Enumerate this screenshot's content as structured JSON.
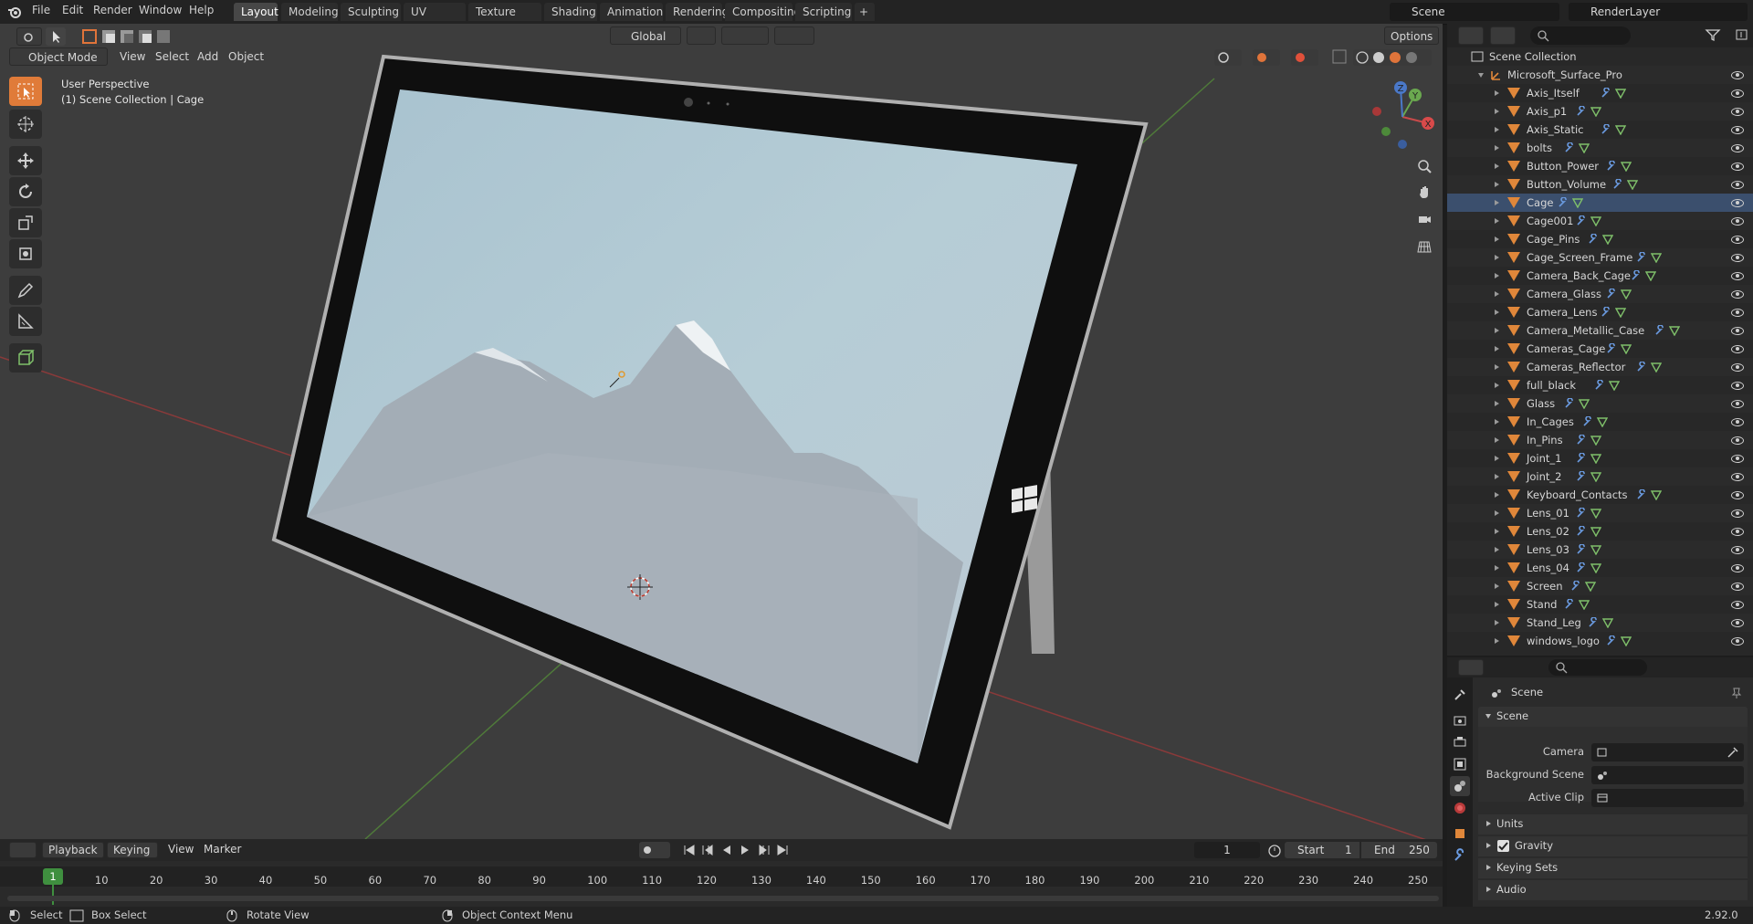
{
  "menubar": {
    "items": [
      "File",
      "Edit",
      "Render",
      "Window",
      "Help"
    ],
    "workspaces": [
      "Layout",
      "Modeling",
      "Sculpting",
      "UV Editing",
      "Texture Paint",
      "Shading",
      "Animation",
      "Rendering",
      "Compositing",
      "Scripting"
    ],
    "active_workspace": "Layout",
    "add_tab": "+",
    "scene_name": "Scene",
    "render_layer": "RenderLayer"
  },
  "viewport": {
    "mode": "Object Mode",
    "menu": [
      "View",
      "Select",
      "Add",
      "Object"
    ],
    "transform_orientation": "Global",
    "options_label": "Options",
    "overlay_title": "User Perspective",
    "overlay_subtitle": "(1) Scene Collection | Cage",
    "gizmo": {
      "x": "X",
      "y": "Y",
      "z": "Z"
    }
  },
  "outliner": {
    "root": "Scene Collection",
    "collection": "Microsoft_Surface_Pro",
    "selected": "Cage",
    "objects": [
      "Axis_Itself",
      "Axis_p1",
      "Axis_Static",
      "bolts",
      "Button_Power",
      "Button_Volume",
      "Cage",
      "Cage001",
      "Cage_Pins",
      "Cage_Screen_Frame",
      "Camera_Back_Cage",
      "Camera_Glass",
      "Camera_Lens",
      "Camera_Metallic_Case",
      "Cameras_Cage",
      "Cameras_Reflector",
      "full_black",
      "Glass",
      "In_Cages",
      "In_Pins",
      "Joint_1",
      "Joint_2",
      "Keyboard_Contacts",
      "Lens_01",
      "Lens_02",
      "Lens_03",
      "Lens_04",
      "Screen",
      "Stand",
      "Stand_Leg",
      "windows_logo"
    ]
  },
  "properties": {
    "context": "Scene",
    "panel_title": "Scene",
    "camera_label": "Camera",
    "background_scene_label": "Background Scene",
    "active_clip_label": "Active Clip",
    "sections": [
      "Units",
      "Gravity",
      "Keying Sets",
      "Audio"
    ],
    "gravity_checked": true
  },
  "timeline": {
    "playback": "Playback",
    "keying": "Keying",
    "menu": [
      "View",
      "Marker"
    ],
    "current_frame": "1",
    "start_label": "Start",
    "start": "1",
    "end_label": "End",
    "end": "250",
    "ticks": [
      "1",
      "10",
      "20",
      "30",
      "40",
      "50",
      "60",
      "70",
      "80",
      "90",
      "100",
      "110",
      "120",
      "130",
      "140",
      "150",
      "160",
      "170",
      "180",
      "190",
      "200",
      "210",
      "220",
      "230",
      "240",
      "250"
    ]
  },
  "statusbar": {
    "select": "Select",
    "box_select": "Box Select",
    "rotate_view": "Rotate View",
    "context_menu": "Object Context Menu",
    "version": "2.92.0"
  },
  "colors": {
    "accent": "#e07b39",
    "mesh_icon": "#e0873a",
    "selection": "#3b4f6d",
    "x_axis": "#c23b3b",
    "y_axis": "#5a9e3c"
  }
}
